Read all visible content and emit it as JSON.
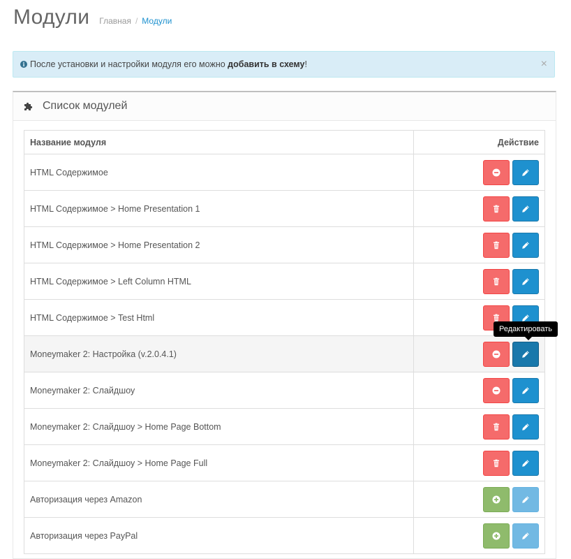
{
  "header": {
    "title": "Модули",
    "breadcrumb": [
      {
        "label": "Главная"
      },
      {
        "label": "Модули"
      }
    ],
    "breadcrumb_sep": "/"
  },
  "alert": {
    "text_before": "После установки и настройки модуля его можно ",
    "link": "добавить в схему",
    "text_after": "!",
    "close": "×"
  },
  "panel": {
    "title": "Список модулей",
    "icon": "puzzle-icon"
  },
  "table": {
    "headers": {
      "name": "Название модуля",
      "action": "Действие"
    },
    "rows": [
      {
        "name": "HTML Содержимое",
        "left_action": "uninstall",
        "right_action": "edit"
      },
      {
        "name": "HTML Содержимое > Home Presentation 1",
        "left_action": "delete",
        "right_action": "edit"
      },
      {
        "name": "HTML Содержимое > Home Presentation 2",
        "left_action": "delete",
        "right_action": "edit"
      },
      {
        "name": "HTML Содержимое > Left Column HTML",
        "left_action": "delete",
        "right_action": "edit"
      },
      {
        "name": "HTML Содержимое > Test Html",
        "left_action": "delete",
        "right_action": "edit"
      },
      {
        "name": "Moneymaker 2: Настройка (v.2.0.4.1)",
        "left_action": "uninstall",
        "right_action": "edit-active"
      },
      {
        "name": "Moneymaker 2: Слайдшоу",
        "left_action": "uninstall",
        "right_action": "edit"
      },
      {
        "name": "Moneymaker 2: Слайдшоу > Home Page Bottom",
        "left_action": "delete",
        "right_action": "edit"
      },
      {
        "name": "Moneymaker 2: Слайдшоу > Home Page Full",
        "left_action": "delete",
        "right_action": "edit"
      },
      {
        "name": "Авторизация через Amazon",
        "left_action": "install",
        "right_action": "edit-disabled"
      },
      {
        "name": "Авторизация через PayPal",
        "left_action": "install",
        "right_action": "edit-disabled"
      }
    ]
  },
  "tooltip": {
    "text": "Редактировать"
  },
  "colors": {
    "danger": "#f56b6b",
    "primary": "#1e91cf",
    "success": "#8fbb6c",
    "info_bg": "#d9edf7"
  }
}
